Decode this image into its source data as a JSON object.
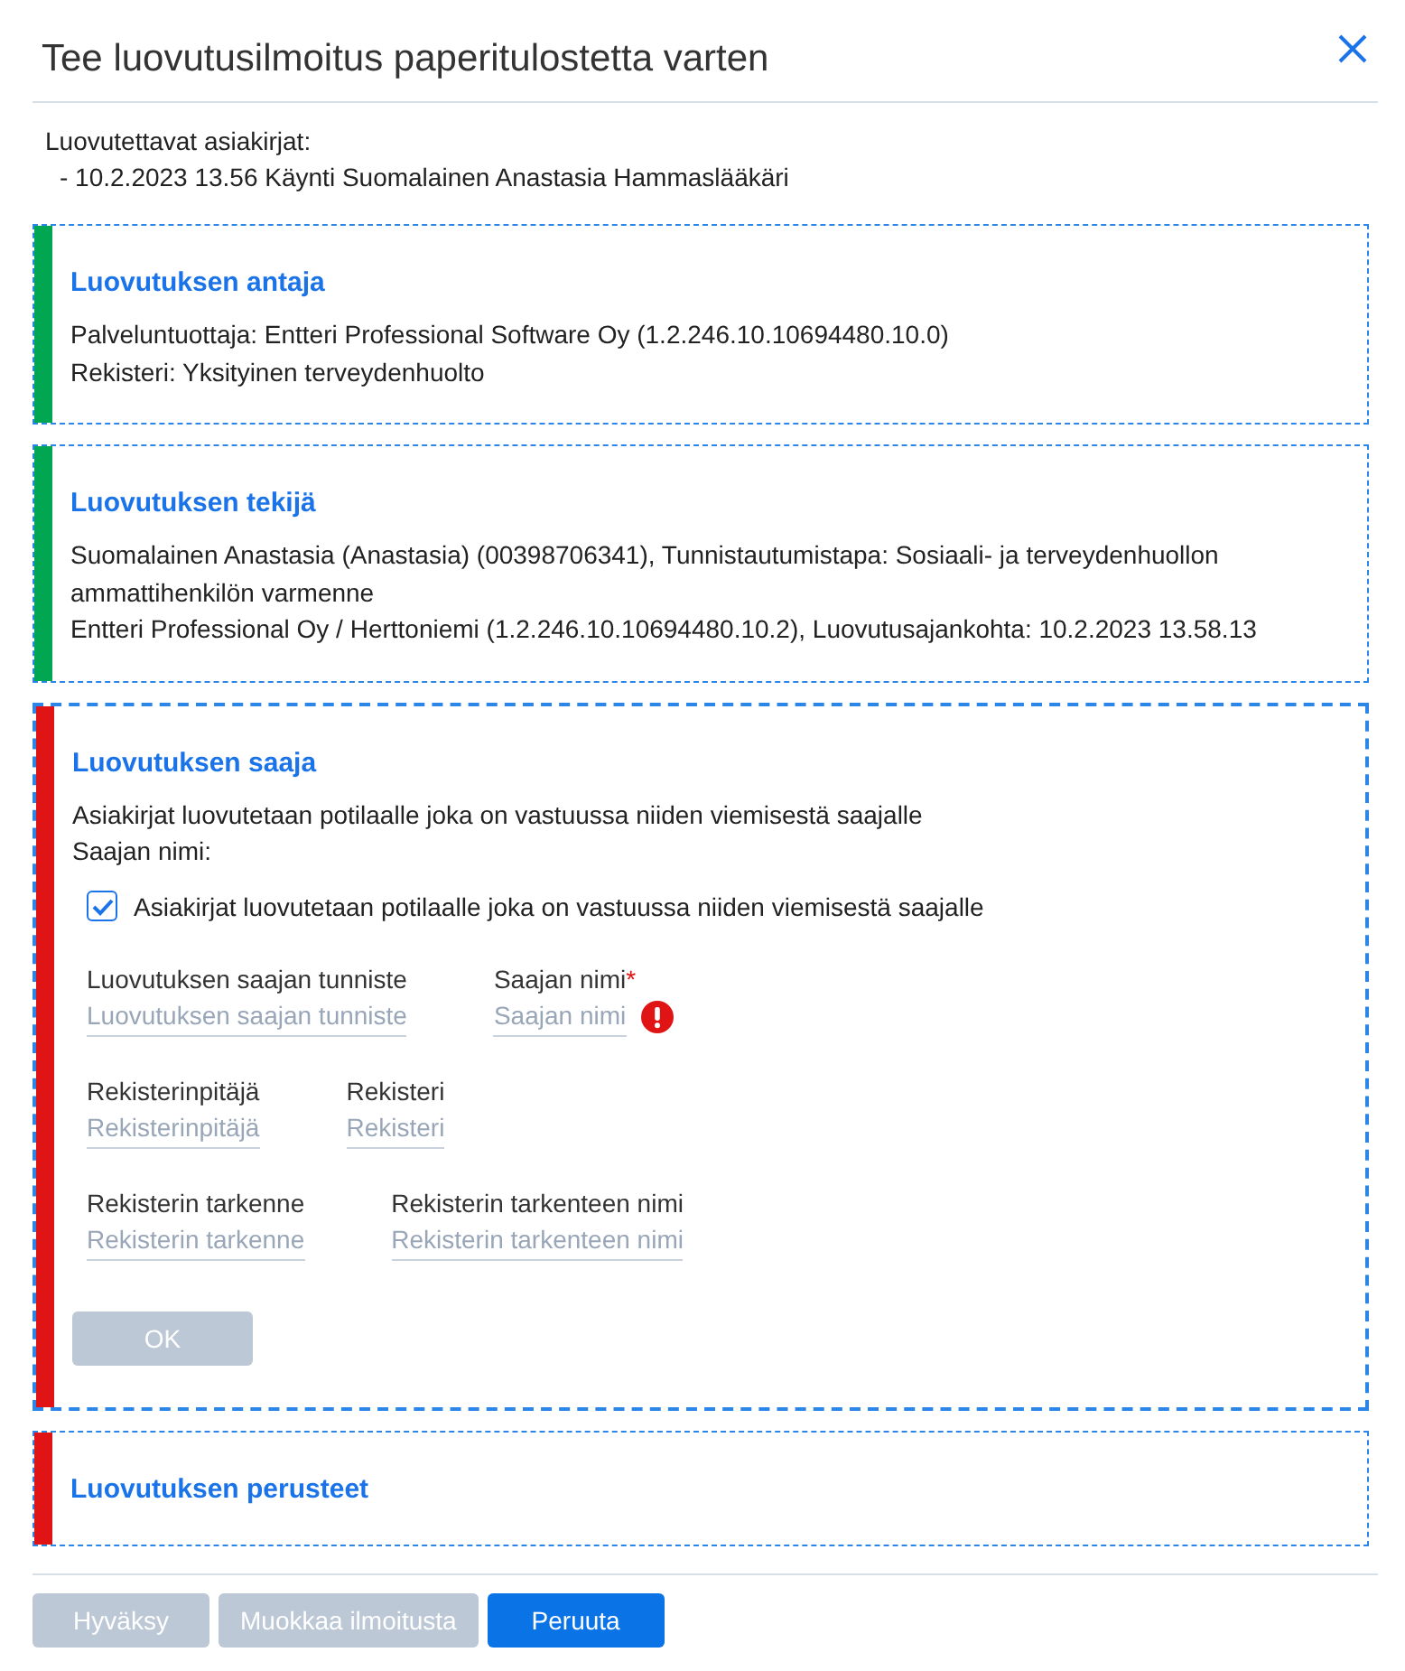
{
  "dialog": {
    "title": "Tee luovutusilmoitus paperitulostetta varten"
  },
  "documents": {
    "label": "Luovutettavat asiakirjat:",
    "items": [
      "- 10.2.2023 13.56 Käynti Suomalainen Anastasia Hammaslääkäri"
    ]
  },
  "sections": [
    {
      "title": "Luovutuksen antaja",
      "color": "#00a651",
      "selected": false,
      "lines": [
        "Palveluntuottaja: Entteri Professional Software Oy (1.2.246.10.10694480.10.0)",
        "Rekisteri: Yksityinen terveydenhuolto"
      ]
    },
    {
      "title": "Luovutuksen tekijä",
      "color": "#00a651",
      "selected": false,
      "lines": [
        "Suomalainen Anastasia (Anastasia) (00398706341), Tunnistautumistapa: Sosiaali- ja terveydenhuollon ammattihenkilön varmenne",
        "Entteri Professional Oy / Herttoniemi (1.2.246.10.10694480.10.2), Luovutusajankohta: 10.2.2023 13.58.13"
      ]
    },
    {
      "title": "Luovutuksen saaja",
      "color": "#e01414",
      "selected": true,
      "lines": [
        "Asiakirjat luovutetaan potilaalle joka on vastuussa niiden viemisestä saajalle",
        "Saajan nimi:"
      ],
      "checkbox": {
        "label": "Asiakirjat luovutetaan potilaalle joka on vastuussa niiden viemisestä saajalle",
        "checked": true
      },
      "field_rows": [
        {
          "fields": [
            {
              "label": "Luovutuksen saajan tunniste",
              "placeholder": "Luovutuksen saajan tunniste",
              "error": false
            },
            {
              "label": "Saajan nimi",
              "required_mark": "*",
              "placeholder": "Saajan nimi",
              "error": true
            }
          ]
        },
        {
          "fields": [
            {
              "label": "Rekisterinpitäjä",
              "placeholder": "Rekisterinpitäjä",
              "error": false
            },
            {
              "label": "Rekisteri",
              "placeholder": "Rekisteri",
              "error": false
            }
          ]
        },
        {
          "fields": [
            {
              "label": "Rekisterin tarkenne",
              "placeholder": "Rekisterin tarkenne",
              "error": false
            },
            {
              "label": "Rekisterin tarkenteen nimi",
              "placeholder": "Rekisterin tarkenteen nimi",
              "error": false
            }
          ]
        }
      ],
      "button": {
        "label": "OK",
        "disabled": true
      }
    },
    {
      "title": "Luovutuksen perusteet",
      "color": "#e01414",
      "selected": false
    }
  ],
  "footer_buttons": [
    {
      "label": "Hyväksy",
      "disabled": true
    },
    {
      "label": "Muokkaa ilmoitusta",
      "disabled": true
    },
    {
      "label": "Peruuta",
      "disabled": false
    }
  ]
}
